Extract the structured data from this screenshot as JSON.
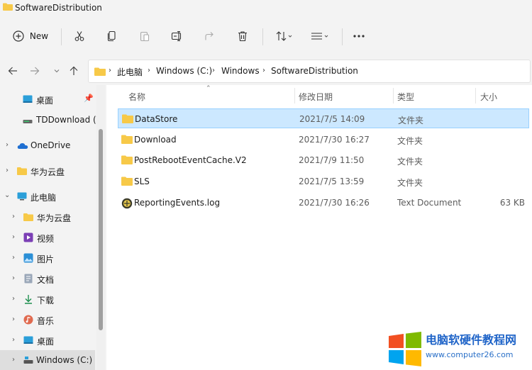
{
  "window": {
    "title": "SoftwareDistribution"
  },
  "toolbar": {
    "new_label": "New",
    "icons": [
      "add-icon",
      "cut-icon",
      "copy-icon",
      "paste-icon",
      "rename-icon",
      "share-icon",
      "delete-icon",
      "sort-icon",
      "view-icon",
      "more-icon"
    ]
  },
  "breadcrumb": [
    "此电脑",
    "Windows (C:)",
    "Windows",
    "SoftwareDistribution"
  ],
  "nav": [
    {
      "label": "桌面",
      "icon": "desktop-icon",
      "pinned": true
    },
    {
      "label": "TDDownload (\\",
      "icon": "drive-icon"
    },
    {
      "label": "OneDrive",
      "icon": "cloud-icon"
    },
    {
      "label": "华为云盘",
      "icon": "folder-icon"
    },
    {
      "label": "此电脑",
      "icon": "pc-icon"
    },
    {
      "label": "华为云盘",
      "icon": "folder-icon"
    },
    {
      "label": "视频",
      "icon": "video-icon"
    },
    {
      "label": "图片",
      "icon": "pictures-icon"
    },
    {
      "label": "文档",
      "icon": "documents-icon"
    },
    {
      "label": "下载",
      "icon": "download-icon"
    },
    {
      "label": "音乐",
      "icon": "music-icon"
    },
    {
      "label": "桌面",
      "icon": "desktop-icon"
    },
    {
      "label": "Windows (C:)",
      "icon": "drive-icon",
      "selected": true
    }
  ],
  "columns": {
    "name": "名称",
    "date": "修改日期",
    "type": "类型",
    "size": "大小"
  },
  "files": [
    {
      "name": "DataStore",
      "date": "2021/7/5 14:09",
      "type": "文件夹",
      "size": "",
      "icon": "folder-icon",
      "selected": true
    },
    {
      "name": "Download",
      "date": "2021/7/30 16:27",
      "type": "文件夹",
      "size": "",
      "icon": "folder-icon"
    },
    {
      "name": "PostRebootEventCache.V2",
      "date": "2021/7/9 11:50",
      "type": "文件夹",
      "size": "",
      "icon": "folder-icon"
    },
    {
      "name": "SLS",
      "date": "2021/7/5 13:59",
      "type": "文件夹",
      "size": "",
      "icon": "folder-icon"
    },
    {
      "name": "ReportingEvents.log",
      "date": "2021/7/30 16:26",
      "type": "Text Document",
      "size": "63 KB",
      "icon": "log-file-icon"
    }
  ],
  "watermark": {
    "title": "电脑软硬件教程网",
    "url": "www.computer26.com"
  },
  "colors": {
    "accent": "#0067c0",
    "folder": "#f7c948",
    "selection": "#cce8ff"
  }
}
